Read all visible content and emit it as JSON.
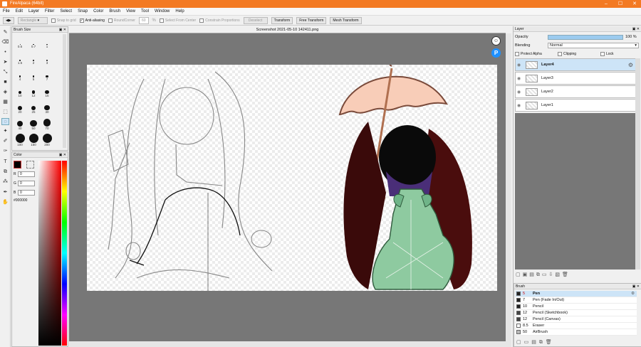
{
  "window": {
    "title": "FireAlpaca (64bit)",
    "min": "–",
    "max": "☐",
    "close": "✕"
  },
  "menu": [
    "File",
    "Edit",
    "Layer",
    "Filter",
    "Select",
    "Snap",
    "Color",
    "Brush",
    "View",
    "Tool",
    "Window",
    "Help"
  ],
  "toolbar": {
    "shape": "Rectangle",
    "snap_to_grid": "Snap to grid",
    "anti_aliasing": "Anti-aliasing",
    "round_corner_label": "RoundCorner",
    "round_corner_value": "60",
    "percent": "%",
    "select_from_center": "Select From Center",
    "constrain_proportions": "Constrain Proportions",
    "deselect": "Deselect",
    "transform": "Transform",
    "free_transform": "Free Transform",
    "mesh_transform": "Mesh Transform"
  },
  "brush_size": {
    "title": "Brush Size",
    "sizes": [
      "0.5",
      "0.7",
      "1",
      "1.5",
      "2",
      "3",
      "4",
      "5",
      "7",
      "10",
      "12",
      "15",
      "20",
      "25",
      "30",
      "40",
      "50",
      "70",
      "100",
      "150",
      "200"
    ]
  },
  "color_panel": {
    "title": "Color",
    "r_label": "R",
    "g_label": "G",
    "b_label": "B",
    "r": "0",
    "g": "0",
    "b": "0",
    "hex": "#000000"
  },
  "document": {
    "tab": "Screenshot 2021-05-10 142411.png"
  },
  "layer_panel": {
    "title": "Layer",
    "opacity_label": "Opacity",
    "opacity_value": "100 %",
    "opacity": 1.0,
    "blending_label": "Blending",
    "blending_value": "Normal",
    "protect_alpha": "Protect Alpha",
    "clipping": "Clipping",
    "lock": "Lock",
    "layers": [
      {
        "name": "Layer4"
      },
      {
        "name": "Layer3"
      },
      {
        "name": "Layer2"
      },
      {
        "name": "Layer1"
      }
    ]
  },
  "brush_panel": {
    "title": "Brush",
    "brushes": [
      {
        "size": "5",
        "name": "Pen"
      },
      {
        "size": "7",
        "name": "Pen (Fade In/Out)"
      },
      {
        "size": "10",
        "name": "Pencil"
      },
      {
        "size": "12",
        "name": "Pencil (Sketchbook)"
      },
      {
        "size": "12",
        "name": "Pencil (Canvas)"
      },
      {
        "size": "8.5",
        "name": "Eraser"
      },
      {
        "size": "50",
        "name": "AirBrush"
      }
    ]
  },
  "colors": {
    "accent": "#f37a23",
    "selection": "#cde4f7",
    "primary": "#000000"
  }
}
